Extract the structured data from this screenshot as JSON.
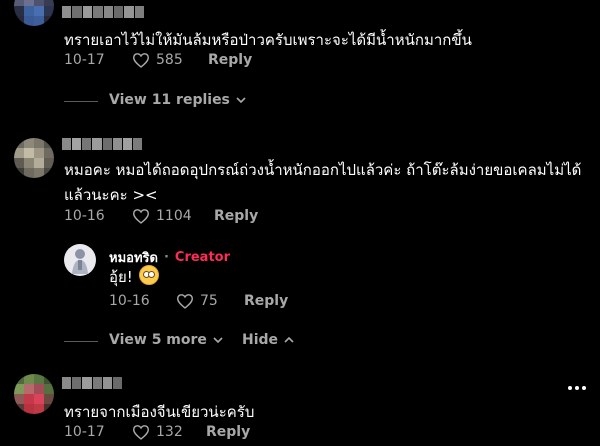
{
  "comments": [
    {
      "text": "ทรายเอาไว้ไม่ให้มันล้มหรือป่าวครับเพราะจะได้มีน้ำหนักมากขึ้น",
      "date": "10-17",
      "likes": "585",
      "reply_label": "Reply",
      "view_replies_label": "View 11 replies"
    },
    {
      "text_line1": "หมอคะ หมอได้ถอดอุปกรณ์ถ่วงน้ำหนักออกไปแล้วค่ะ ถ้าโต๊ะล้มง่ายขอเคลมไม่ได้",
      "text_line2": "แล้วนะคะ ><",
      "date": "10-16",
      "likes": "1104",
      "reply_label": "Reply",
      "reply": {
        "author": "หมอทริด",
        "separator": "·",
        "creator_label": "Creator",
        "text": "อุ้ย!",
        "date": "10-16",
        "likes": "75",
        "reply_label": "Reply"
      },
      "view_more_label": "View 5 more",
      "hide_label": "Hide"
    },
    {
      "text": "ทรายจากเมืองจีนเขียวน่ะครับ",
      "date": "10-17",
      "likes": "132",
      "reply_label": "Reply"
    }
  ],
  "icons": {
    "heart": "heart-icon",
    "chevron_down": "chevron-down-icon",
    "chevron_up": "chevron-up-icon",
    "more": "more-horizontal-icon",
    "emoji": "flushed-face-emoji-icon"
  },
  "colors": {
    "background": "#000000",
    "text": "#ffffff",
    "muted": "#a8a8a8",
    "creator": "#fe2c55"
  }
}
